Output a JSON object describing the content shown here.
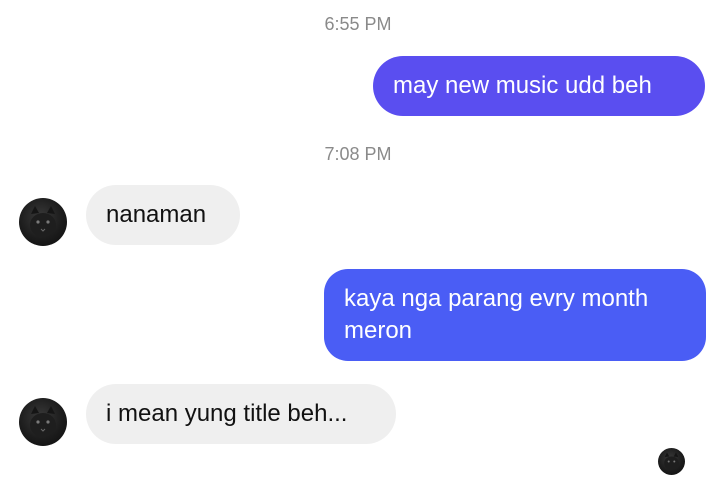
{
  "colors": {
    "outgoing_bubble_1": "#5a4ef0",
    "outgoing_bubble_2": "#4a5df5",
    "incoming_bubble": "#efefef",
    "timestamp_text": "#8a8a8a"
  },
  "thread": {
    "timestamps": [
      "6:55 PM",
      "7:08 PM"
    ],
    "messages": [
      {
        "direction": "outgoing",
        "text": "may new music udd beh"
      },
      {
        "direction": "incoming",
        "text": "nanaman",
        "avatar": "cat-avatar-icon"
      },
      {
        "direction": "outgoing",
        "text": "kaya nga parang evry month meron"
      },
      {
        "direction": "incoming",
        "text": "i mean yung title beh...",
        "avatar": "cat-avatar-icon"
      }
    ],
    "seen_indicator": "seen-avatar-icon"
  }
}
